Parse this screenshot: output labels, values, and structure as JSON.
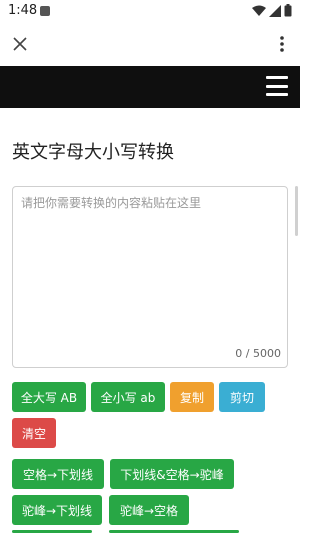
{
  "status_bar": {
    "time": "1:48"
  },
  "title": "英文字母大小写转换",
  "input": {
    "placeholder": "请把你需要转换的内容粘贴在这里",
    "value": "",
    "counter": "0 / 5000"
  },
  "buttons": {
    "upper": "全大写 AB",
    "lower": "全小写 ab",
    "copy": "复制",
    "cut": "剪切",
    "clear": "清空",
    "space_to_underscore": "空格→下划线",
    "underscore_space_to_camel": "下划线&空格→驼峰",
    "camel_to_underscore": "驼峰→下划线",
    "camel_to_space": "驼峰→空格"
  },
  "colors": {
    "navbar": "#0f0f0f",
    "green": "#28a745",
    "orange": "#f0a02e",
    "teal": "#3aaed3",
    "red": "#dc4a48"
  },
  "icons": [
    "wifi-icon",
    "signal-icon",
    "battery-icon",
    "close-icon",
    "more-vert-icon",
    "menu-icon"
  ]
}
